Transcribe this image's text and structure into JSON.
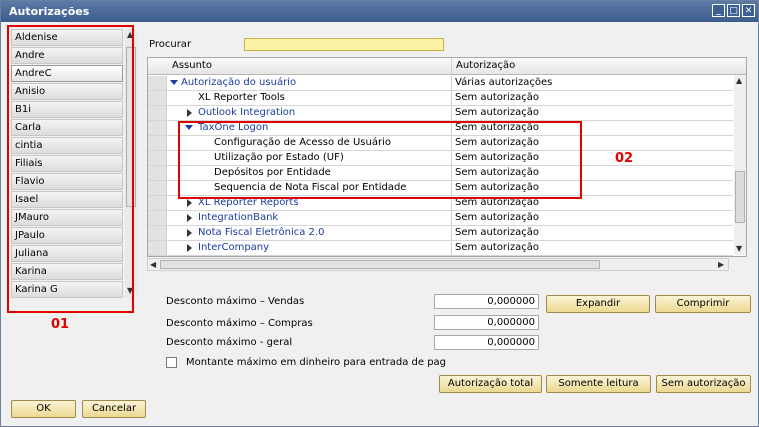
{
  "window": {
    "title": "Autorizações",
    "buttons": [
      "_",
      "□",
      "✕"
    ]
  },
  "users": [
    "Aldenise",
    "Andre",
    "AndreC",
    "Anisio",
    "B1i",
    "Carla",
    "cintia",
    "Filiais",
    "Flavio",
    "Isael",
    "JMauro",
    "JPaulo",
    "Juliana",
    "Karina",
    "Karina G"
  ],
  "search": {
    "label": "Procurar",
    "value": ""
  },
  "grid": {
    "headers": {
      "subject": "Assunto",
      "auth": "Autorização"
    },
    "rows": [
      {
        "subject": "Autorização do usuário",
        "auth": "Várias autorizações"
      },
      {
        "subject": "XL Reporter Tools",
        "auth": "Sem autorização"
      },
      {
        "subject": "Outlook Integration",
        "auth": "Sem autorização"
      },
      {
        "subject": "TaxOne Logon",
        "auth": "Sem autorização"
      },
      {
        "subject": "Configuração de Acesso de Usuário",
        "auth": "Sem autorização"
      },
      {
        "subject": "Utilização por Estado (UF)",
        "auth": "Sem autorização"
      },
      {
        "subject": "Depósitos por Entidade",
        "auth": "Sem autorização"
      },
      {
        "subject": "Sequencia de Nota Fiscal por Entidade",
        "auth": "Sem autorização"
      },
      {
        "subject": "XL Reporter Reports",
        "auth": "Sem autorização"
      },
      {
        "subject": "IntegrationBank",
        "auth": "Sem autorização"
      },
      {
        "subject": "Nota Fiscal Eletrônica 2.0",
        "auth": "Sem autorização"
      },
      {
        "subject": "InterCompany",
        "auth": "Sem autorização"
      }
    ]
  },
  "fields": {
    "max_discount_sales": {
      "label": "Desconto máximo – Vendas",
      "value": "0,000000"
    },
    "max_discount_purchases": {
      "label": "Desconto máximo – Compras",
      "value": "0,000000"
    },
    "max_discount_general": {
      "label": "Desconto máximo - geral",
      "value": "0,000000"
    }
  },
  "checkbox": {
    "label": "Montante máximo em dinheiro para entrada de pag",
    "checked": false
  },
  "buttons": {
    "expand": "Expandir",
    "collapse": "Comprimir",
    "full_auth": "Autorização total",
    "read_only": "Somente leitura",
    "no_auth": "Sem autorização",
    "ok": "OK",
    "cancel": "Cancelar"
  },
  "annotations": {
    "box1": "01",
    "box2": "02"
  },
  "colors": {
    "annotation": "#e00000",
    "title_bar": "#3c5c8c",
    "link": "#1a3d9e",
    "search_bg": "#fdf3a6",
    "button_bg": "#ecd892"
  }
}
